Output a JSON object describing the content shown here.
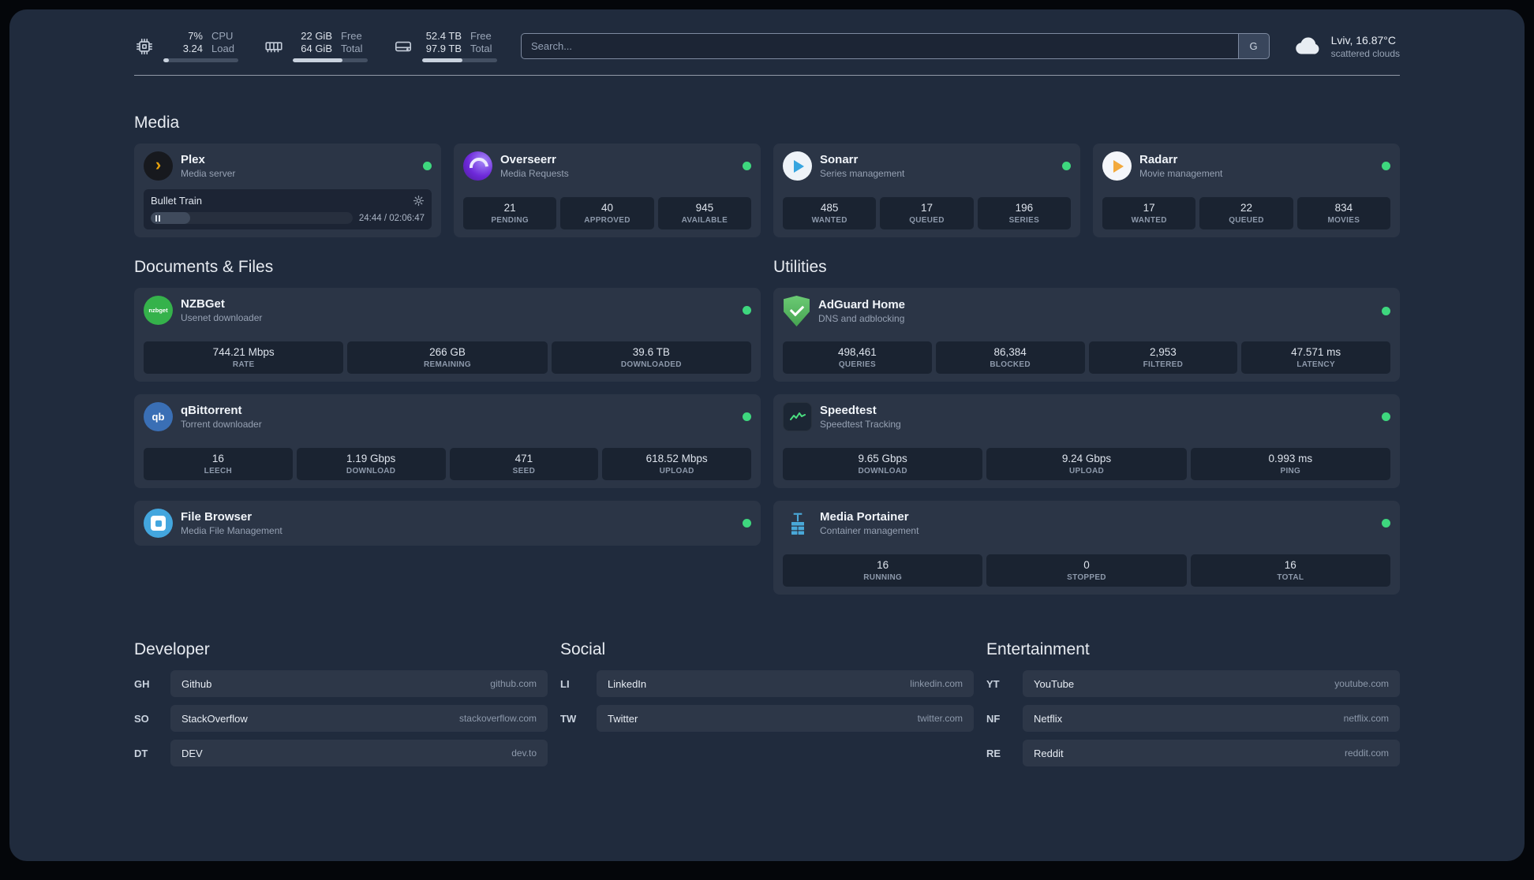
{
  "topbar": {
    "cpu": {
      "values": [
        "7%",
        "3.24"
      ],
      "labels": [
        "CPU",
        "Load"
      ],
      "bar": "width:7%"
    },
    "memory": {
      "values": [
        "22 GiB",
        "64 GiB"
      ],
      "labels": [
        "Free",
        "Total"
      ],
      "bar": "width:66%"
    },
    "disk": {
      "values": [
        "52.4 TB",
        "97.9 TB"
      ],
      "labels": [
        "Free",
        "Total"
      ],
      "bar": "width:54%"
    },
    "search": {
      "placeholder": "Search...",
      "provider": "G"
    },
    "weather": {
      "location": "Lviv, 16.87°C",
      "condition": "scattered clouds"
    }
  },
  "sections": {
    "media": {
      "title": "Media",
      "items": [
        {
          "name": "Plex",
          "desc": "Media server",
          "player": {
            "title": "Bullet Train",
            "time": "24:44 / 02:06:47",
            "progress": "width:19.5%"
          }
        },
        {
          "name": "Overseerr",
          "desc": "Media Requests",
          "stats": [
            {
              "value": "21",
              "label": "PENDING"
            },
            {
              "value": "40",
              "label": "APPROVED"
            },
            {
              "value": "945",
              "label": "AVAILABLE"
            }
          ]
        },
        {
          "name": "Sonarr",
          "desc": "Series management",
          "stats": [
            {
              "value": "485",
              "label": "WANTED"
            },
            {
              "value": "17",
              "label": "QUEUED"
            },
            {
              "value": "196",
              "label": "SERIES"
            }
          ]
        },
        {
          "name": "Radarr",
          "desc": "Movie management",
          "stats": [
            {
              "value": "17",
              "label": "WANTED"
            },
            {
              "value": "22",
              "label": "QUEUED"
            },
            {
              "value": "834",
              "label": "MOVIES"
            }
          ]
        }
      ]
    },
    "documents": {
      "title": "Documents & Files",
      "items": [
        {
          "name": "NZBGet",
          "desc": "Usenet downloader",
          "stats": [
            {
              "value": "744.21 Mbps",
              "label": "RATE"
            },
            {
              "value": "266 GB",
              "label": "REMAINING"
            },
            {
              "value": "39.6 TB",
              "label": "DOWNLOADED"
            }
          ]
        },
        {
          "name": "qBittorrent",
          "desc": "Torrent downloader",
          "stats": [
            {
              "value": "16",
              "label": "LEECH"
            },
            {
              "value": "1.19 Gbps",
              "label": "DOWNLOAD"
            },
            {
              "value": "471",
              "label": "SEED"
            },
            {
              "value": "618.52 Mbps",
              "label": "UPLOAD"
            }
          ]
        },
        {
          "name": "File Browser",
          "desc": "Media File Management"
        }
      ]
    },
    "utilities": {
      "title": "Utilities",
      "items": [
        {
          "name": "AdGuard Home",
          "desc": "DNS and adblocking",
          "stats": [
            {
              "value": "498,461",
              "label": "QUERIES"
            },
            {
              "value": "86,384",
              "label": "BLOCKED"
            },
            {
              "value": "2,953",
              "label": "FILTERED"
            },
            {
              "value": "47.571 ms",
              "label": "LATENCY"
            }
          ]
        },
        {
          "name": "Speedtest",
          "desc": "Speedtest Tracking",
          "stats": [
            {
              "value": "9.65 Gbps",
              "label": "DOWNLOAD"
            },
            {
              "value": "9.24 Gbps",
              "label": "UPLOAD"
            },
            {
              "value": "0.993 ms",
              "label": "PING"
            }
          ]
        },
        {
          "name": "Media Portainer",
          "desc": "Container management",
          "stats": [
            {
              "value": "16",
              "label": "RUNNING"
            },
            {
              "value": "0",
              "label": "STOPPED"
            },
            {
              "value": "16",
              "label": "TOTAL"
            }
          ]
        }
      ]
    }
  },
  "bookmarks": [
    {
      "title": "Developer",
      "items": [
        {
          "abbr": "GH",
          "name": "Github",
          "url": "github.com"
        },
        {
          "abbr": "SO",
          "name": "StackOverflow",
          "url": "stackoverflow.com"
        },
        {
          "abbr": "DT",
          "name": "DEV",
          "url": "dev.to"
        }
      ]
    },
    {
      "title": "Social",
      "items": [
        {
          "abbr": "LI",
          "name": "LinkedIn",
          "url": "linkedin.com"
        },
        {
          "abbr": "TW",
          "name": "Twitter",
          "url": "twitter.com"
        }
      ]
    },
    {
      "title": "Entertainment",
      "items": [
        {
          "abbr": "YT",
          "name": "YouTube",
          "url": "youtube.com"
        },
        {
          "abbr": "NF",
          "name": "Netflix",
          "url": "netflix.com"
        },
        {
          "abbr": "RE",
          "name": "Reddit",
          "url": "reddit.com"
        }
      ]
    }
  ],
  "icons": {
    "plex": "›",
    "qbittorrent": "qb",
    "nzbget": "nzbget"
  },
  "colors": {
    "status_online": "#3ed77e",
    "dot_style": "background:#3ed77e"
  }
}
